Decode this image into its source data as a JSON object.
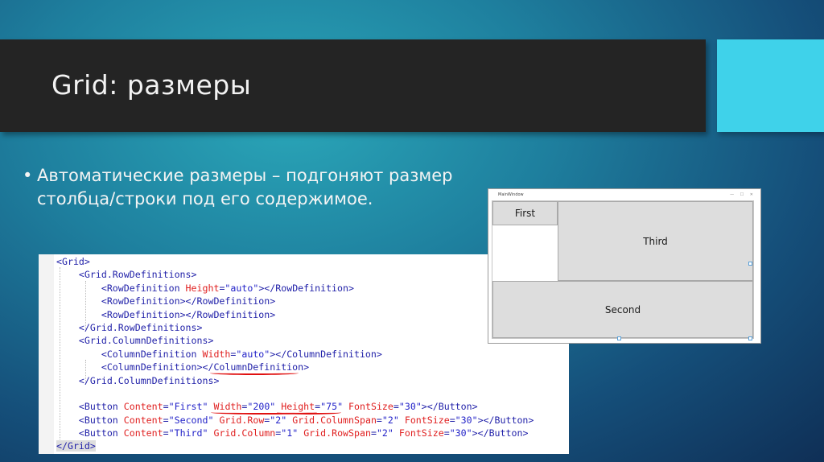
{
  "slide": {
    "title": "Grid: размеры",
    "bullet_marker": "•",
    "bullet_text": "Автоматические размеры – подгоняют размер столбца/строки под его содержимое."
  },
  "code": {
    "lines": [
      {
        "indent": "",
        "parts": [
          {
            "c": "t",
            "s": "<Grid>"
          }
        ]
      },
      {
        "indent": "    ",
        "parts": [
          {
            "c": "t",
            "s": "<Grid.RowDefinitions>"
          }
        ]
      },
      {
        "indent": "        ",
        "parts": [
          {
            "c": "t",
            "s": "<RowDefinition "
          },
          {
            "c": "a",
            "s": "Height"
          },
          {
            "c": "t",
            "s": "="
          },
          {
            "c": "v",
            "s": "\"auto\""
          },
          {
            "c": "t",
            "s": "></RowDefinition>"
          }
        ]
      },
      {
        "indent": "        ",
        "parts": [
          {
            "c": "t",
            "s": "<RowDefinition></RowDefinition>"
          }
        ]
      },
      {
        "indent": "        ",
        "parts": [
          {
            "c": "t",
            "s": "<RowDefinition></RowDefinition>"
          }
        ]
      },
      {
        "indent": "    ",
        "parts": [
          {
            "c": "t",
            "s": "</Grid.RowDefinitions>"
          }
        ]
      },
      {
        "indent": "    ",
        "parts": [
          {
            "c": "t",
            "s": "<Grid.ColumnDefinitions>"
          }
        ]
      },
      {
        "indent": "        ",
        "parts": [
          {
            "c": "t",
            "s": "<ColumnDefinition "
          },
          {
            "c": "a",
            "s": "Width"
          },
          {
            "c": "t",
            "s": "="
          },
          {
            "c": "v",
            "s": "\"auto\""
          },
          {
            "c": "t",
            "s": "></ColumnDefinition>"
          }
        ]
      },
      {
        "indent": "        ",
        "parts": [
          {
            "c": "t",
            "s": "<ColumnDefinition></ColumnDefinition>"
          }
        ]
      },
      {
        "indent": "    ",
        "parts": [
          {
            "c": "t",
            "s": "</Grid.ColumnDefinitions>"
          }
        ]
      },
      {
        "indent": "",
        "parts": []
      },
      {
        "indent": "    ",
        "parts": [
          {
            "c": "t",
            "s": "<Button "
          },
          {
            "c": "a",
            "s": "Content"
          },
          {
            "c": "t",
            "s": "="
          },
          {
            "c": "v",
            "s": "\"First\""
          },
          {
            "c": "t",
            "s": " "
          },
          {
            "c": "a",
            "s": "Width"
          },
          {
            "c": "t",
            "s": "="
          },
          {
            "c": "v",
            "s": "\"200\""
          },
          {
            "c": "t",
            "s": " "
          },
          {
            "c": "a",
            "s": "Height"
          },
          {
            "c": "t",
            "s": "="
          },
          {
            "c": "v",
            "s": "\"75\""
          },
          {
            "c": "t",
            "s": " "
          },
          {
            "c": "a",
            "s": "FontSize"
          },
          {
            "c": "t",
            "s": "="
          },
          {
            "c": "v",
            "s": "\"30\""
          },
          {
            "c": "t",
            "s": "></Button>"
          }
        ]
      },
      {
        "indent": "    ",
        "parts": [
          {
            "c": "t",
            "s": "<Button "
          },
          {
            "c": "a",
            "s": "Content"
          },
          {
            "c": "t",
            "s": "="
          },
          {
            "c": "v",
            "s": "\"Second\""
          },
          {
            "c": "t",
            "s": " "
          },
          {
            "c": "a",
            "s": "Grid.Row"
          },
          {
            "c": "t",
            "s": "="
          },
          {
            "c": "v",
            "s": "\"2\""
          },
          {
            "c": "t",
            "s": " "
          },
          {
            "c": "a",
            "s": "Grid.ColumnSpan"
          },
          {
            "c": "t",
            "s": "="
          },
          {
            "c": "v",
            "s": "\"2\""
          },
          {
            "c": "t",
            "s": " "
          },
          {
            "c": "a",
            "s": "FontSize"
          },
          {
            "c": "t",
            "s": "="
          },
          {
            "c": "v",
            "s": "\"30\""
          },
          {
            "c": "t",
            "s": "></Button>"
          }
        ]
      },
      {
        "indent": "    ",
        "parts": [
          {
            "c": "t",
            "s": "<Button "
          },
          {
            "c": "a",
            "s": "Content"
          },
          {
            "c": "t",
            "s": "="
          },
          {
            "c": "v",
            "s": "\"Third\""
          },
          {
            "c": "t",
            "s": " "
          },
          {
            "c": "a",
            "s": "Grid.Column"
          },
          {
            "c": "t",
            "s": "="
          },
          {
            "c": "v",
            "s": "\"1\""
          },
          {
            "c": "t",
            "s": " "
          },
          {
            "c": "a",
            "s": "Grid.RowSpan"
          },
          {
            "c": "t",
            "s": "="
          },
          {
            "c": "v",
            "s": "\"2\""
          },
          {
            "c": "t",
            "s": " "
          },
          {
            "c": "a",
            "s": "FontSize"
          },
          {
            "c": "t",
            "s": "="
          },
          {
            "c": "v",
            "s": "\"30\""
          },
          {
            "c": "t",
            "s": "></Button>"
          }
        ]
      },
      {
        "indent": "",
        "parts": [
          {
            "c": "sel",
            "s": "</Grid>"
          }
        ]
      }
    ]
  },
  "preview": {
    "window_title": "MainWindow",
    "window_controls": "— ☐ ✕",
    "buttons": {
      "first": "First",
      "second": "Second",
      "third": "Third"
    }
  },
  "colors": {
    "title_bar": "#242424",
    "accent_block": "#3fd2ea",
    "xaml_tag": "#1f1fa8",
    "xaml_attr": "#e02020",
    "xaml_value": "#2222c8"
  }
}
